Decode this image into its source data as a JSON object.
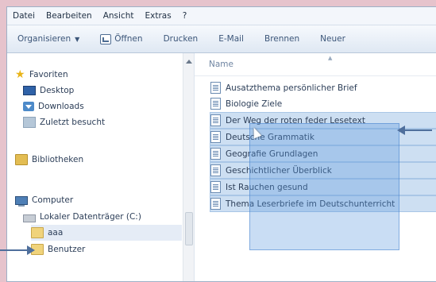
{
  "menubar": {
    "items": [
      "Datei",
      "Bearbeiten",
      "Ansicht",
      "Extras",
      "?"
    ]
  },
  "toolbar": {
    "organize": "Organisieren",
    "open": "Öffnen",
    "print": "Drucken",
    "email": "E-Mail",
    "burn": "Brennen",
    "new": "Neuer"
  },
  "sidebar": {
    "favorites": "Favoriten",
    "desktop": "Desktop",
    "downloads": "Downloads",
    "recent": "Zuletzt besucht",
    "libraries": "Bibliotheken",
    "computer": "Computer",
    "disk": "Lokaler Datenträger (C:)",
    "folder_aaa": "aaa",
    "folder_users": "Benutzer"
  },
  "file_list": {
    "column_name": "Name",
    "files": [
      "Ausatzthema persönlicher Brief",
      "Biologie Ziele",
      "Der Weg der roten feder Lesetext",
      "Deutsche Grammatik",
      "Geografie Grundlagen",
      "Geschichtlicher Überblick",
      "Ist Rauchen gesund",
      "Thema Leserbriefe im Deutschunterricht"
    ]
  },
  "colors": {
    "frame_background": "#e6c3cc",
    "toolbar_text": "#3c5679",
    "selection": "#5696dc"
  }
}
